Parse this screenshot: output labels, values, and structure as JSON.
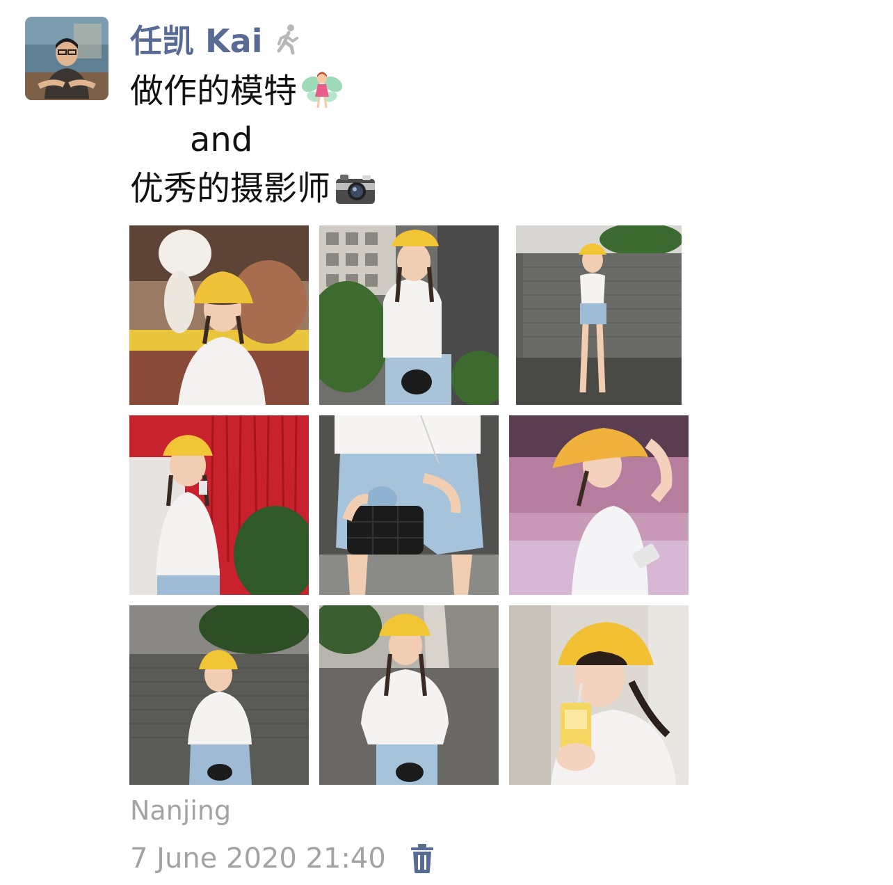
{
  "post": {
    "author": "任凯 Kai",
    "author_color": "#576b95",
    "status_icon": "walking-person-icon",
    "text_lines": [
      "做作的模特",
      "and",
      "优秀的摄影师"
    ],
    "emoji": [
      "fairy-emoji",
      "camera-emoji"
    ],
    "photos": [
      {
        "icon": "photo-thumbnail",
        "scene": "bear-statue"
      },
      {
        "icon": "photo-thumbnail",
        "scene": "lattice-wall"
      },
      {
        "icon": "photo-thumbnail",
        "scene": "brick-wall"
      },
      {
        "icon": "photo-thumbnail",
        "scene": "red-ribbons"
      },
      {
        "icon": "photo-thumbnail",
        "scene": "denim-closeup"
      },
      {
        "icon": "photo-thumbnail",
        "scene": "neon-street"
      },
      {
        "icon": "photo-thumbnail",
        "scene": "grey-wall"
      },
      {
        "icon": "photo-thumbnail",
        "scene": "sidewalk"
      },
      {
        "icon": "photo-thumbnail",
        "scene": "mall-drink"
      }
    ],
    "location": "Nanjing",
    "timestamp": "7 June 2020 21:40",
    "delete_icon": "trash-icon",
    "meta_color": "#a3a3a3"
  }
}
